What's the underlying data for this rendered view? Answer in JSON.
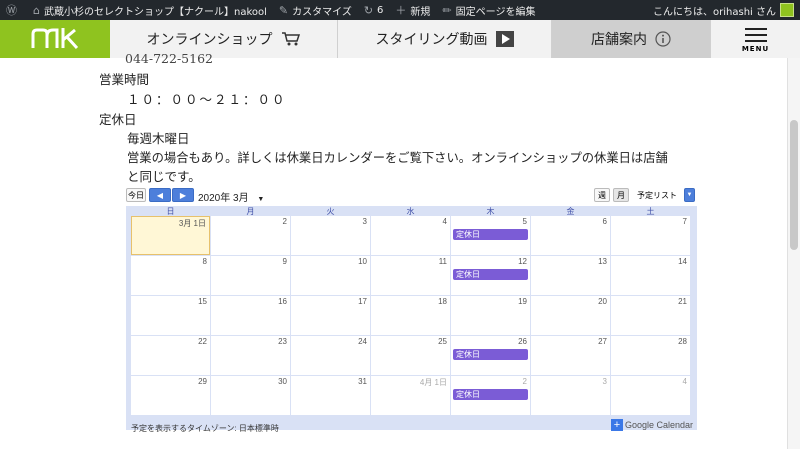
{
  "adminbar": {
    "site_name": "武蔵小杉のセレクトショップ【ナクール】nakool",
    "customize": "カスタマイズ",
    "updates": "6",
    "new": "新規",
    "edit": "固定ページを編集",
    "greeting": "こんにちは、orihashi さん"
  },
  "nav": {
    "tabs": [
      "オンラインショップ",
      "スタイリング動画",
      "店舗案内"
    ],
    "menu_label": "MENU"
  },
  "content": {
    "partial_line": "044-722-5162",
    "hours_label": "営業時間",
    "hours_value": "１０：００～２１：００",
    "closed_label": "定休日",
    "closed_value": "毎週木曜日",
    "note_line1": "営業の場合もあり。詳しくは休業日カレンダーをご覧下さい。オンラインショップの休業日は店舗",
    "note_line2": "と同じです。"
  },
  "calendar": {
    "today_btn": "今日",
    "prev_btn": "◀",
    "next_btn": "▶",
    "month_label": "2020年 3月",
    "view_week": "週",
    "view_month": "月",
    "view_agenda": "予定リスト",
    "weekdays": [
      "日",
      "月",
      "火",
      "水",
      "木",
      "金",
      "土"
    ],
    "weeks": [
      [
        "3月 1日",
        "2",
        "3",
        "4",
        "5",
        "6",
        "7"
      ],
      [
        "8",
        "9",
        "10",
        "11",
        "12",
        "13",
        "14"
      ],
      [
        "15",
        "16",
        "17",
        "18",
        "19",
        "20",
        "21"
      ],
      [
        "22",
        "23",
        "24",
        "25",
        "26",
        "27",
        "28"
      ],
      [
        "29",
        "30",
        "31",
        "4月 1日",
        "2",
        "3",
        "4"
      ]
    ],
    "event_label": "定休日",
    "timezone": "予定を表示するタイムゾーン: 日本標準時",
    "google_calendar": "Google Calendar"
  }
}
